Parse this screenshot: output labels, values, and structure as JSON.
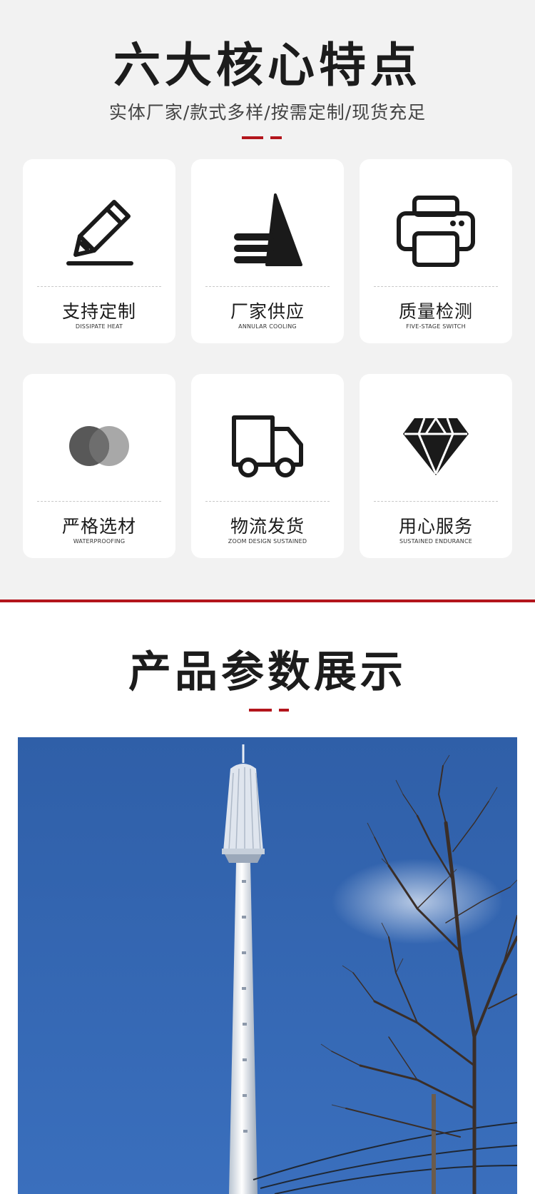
{
  "features": {
    "title": "六大核心特点",
    "subtitle": "实体厂家/款式多样/按需定制/现货充足",
    "cards": [
      {
        "label": "支持定制",
        "sub": "DISSIPATE HEAT",
        "icon": "pencil-icon"
      },
      {
        "label": "厂家供应",
        "sub": "ANNULAR COOLING",
        "icon": "triangle-stack-icon"
      },
      {
        "label": "质量检测",
        "sub": "FIVE-STAGE SWITCH",
        "icon": "printer-icon"
      },
      {
        "label": "严格选材",
        "sub": "WATERPROOFING",
        "icon": "overlap-circles-icon"
      },
      {
        "label": "物流发货",
        "sub": "ZOOM DESIGN SUSTAINED",
        "icon": "truck-icon"
      },
      {
        "label": "用心服务",
        "sub": "SUSTAINED ENDURANCE",
        "icon": "diamond-icon"
      }
    ],
    "accent_color": "#b3151c"
  },
  "product": {
    "title": "产品参数展示",
    "photo_icon": "communication-tower-photo"
  }
}
